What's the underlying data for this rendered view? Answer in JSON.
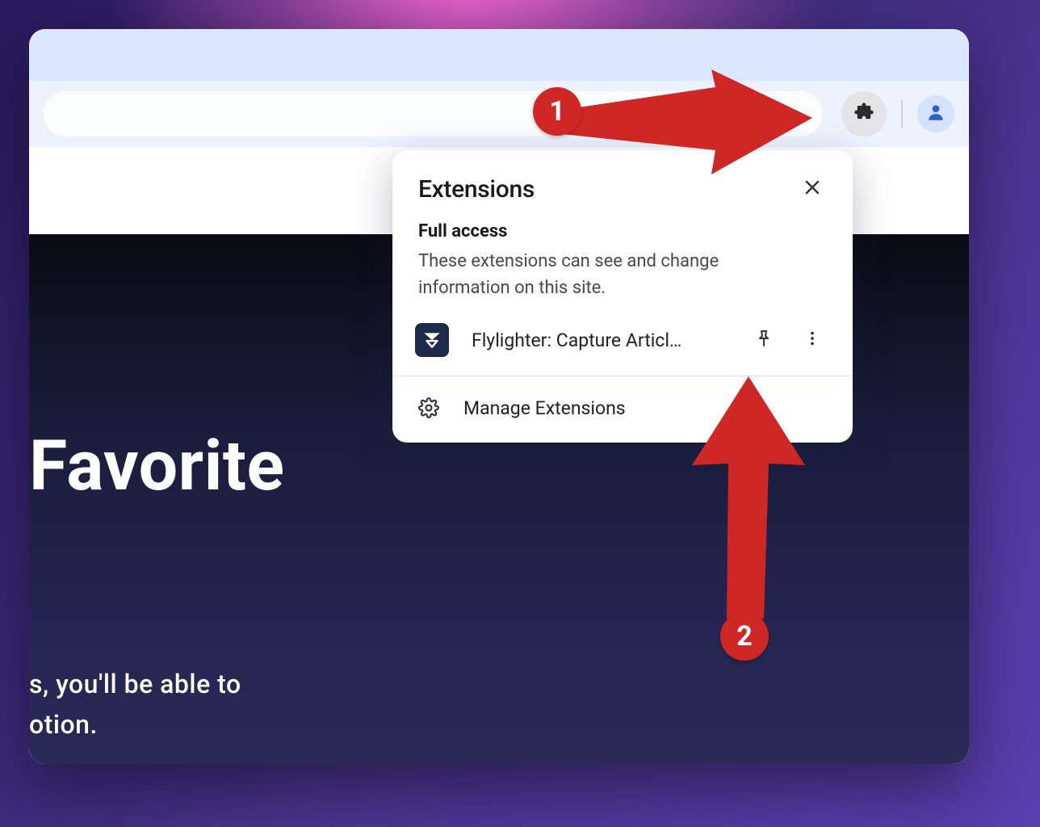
{
  "popup": {
    "title": "Extensions",
    "full_access_title": "Full access",
    "full_access_desc": "These extensions can see and change information on this site.",
    "extension_name": "Flylighter: Capture Articl…",
    "manage_label": "Manage Extensions"
  },
  "page": {
    "headline": "Favorite",
    "sub1": "s, you'll be able to",
    "sub2": "otion."
  },
  "annotations": {
    "badge1": "1",
    "badge2": "2"
  }
}
